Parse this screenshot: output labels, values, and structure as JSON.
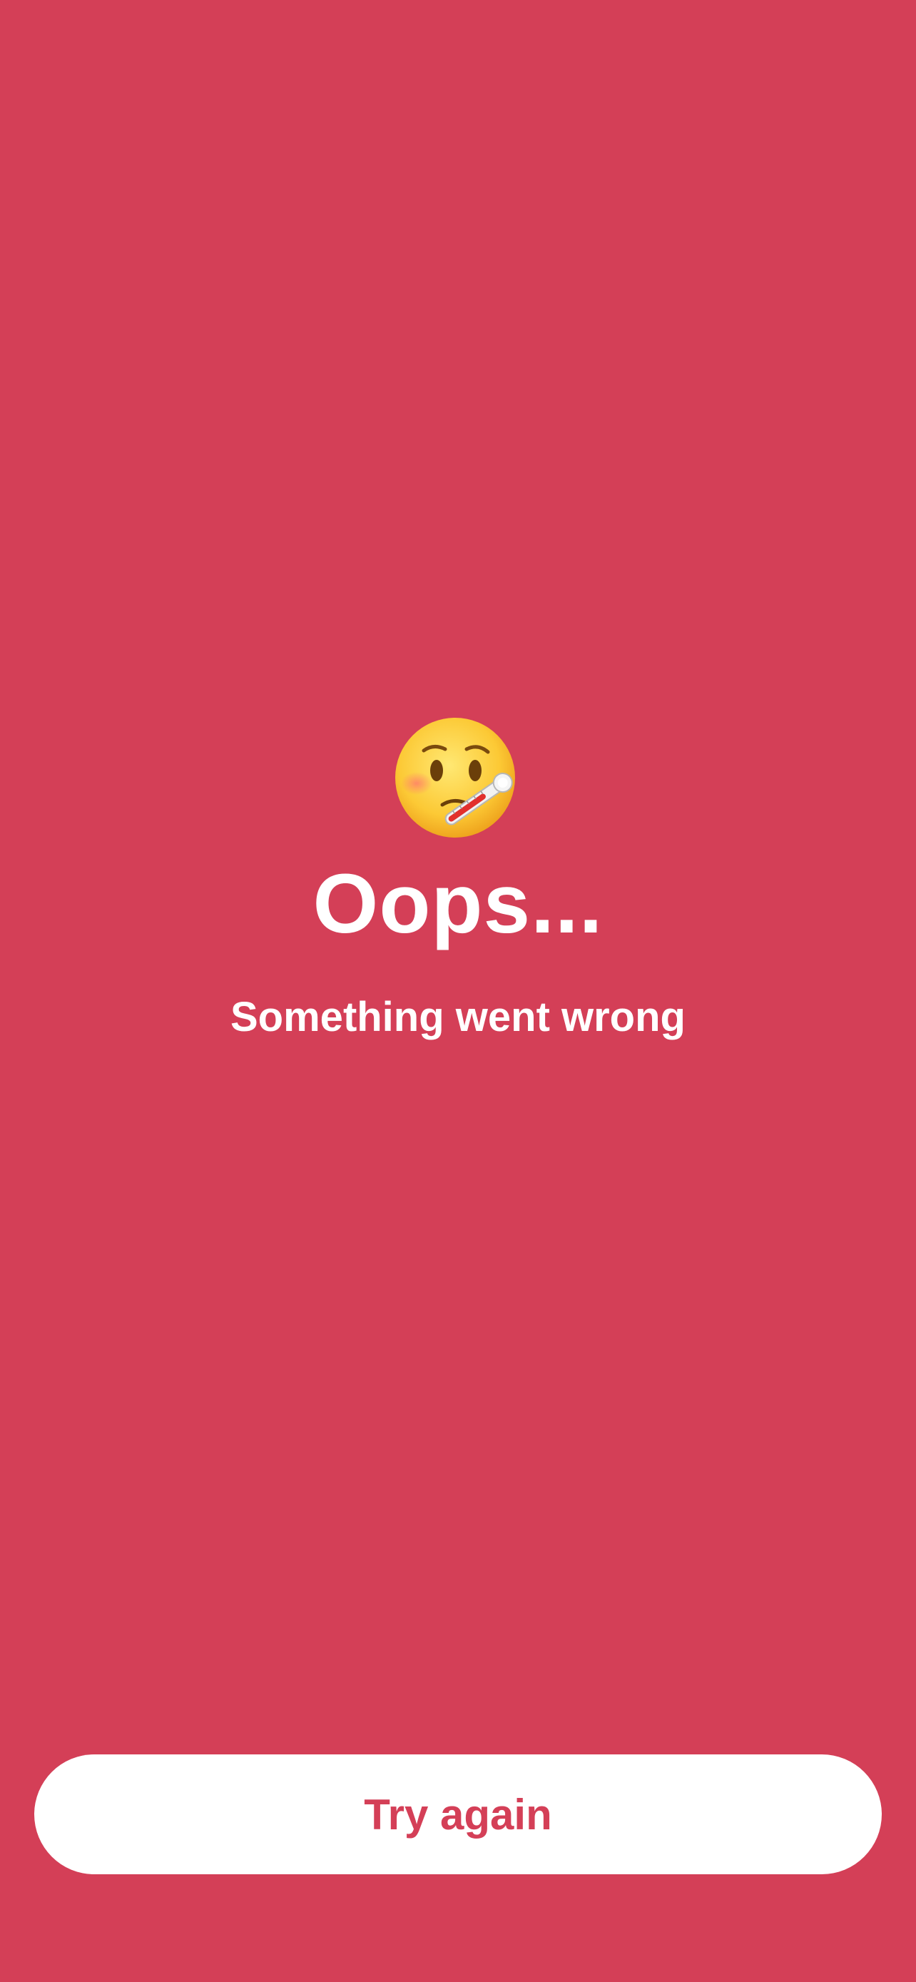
{
  "error_screen": {
    "icon": "face-with-thermometer-icon",
    "title": "Oops...",
    "message": "Something went wrong",
    "retry_label": "Try again"
  },
  "colors": {
    "background": "#D43F57",
    "button_background": "#FFFFFF",
    "button_text": "#D43F57",
    "text": "#FFFFFF"
  }
}
